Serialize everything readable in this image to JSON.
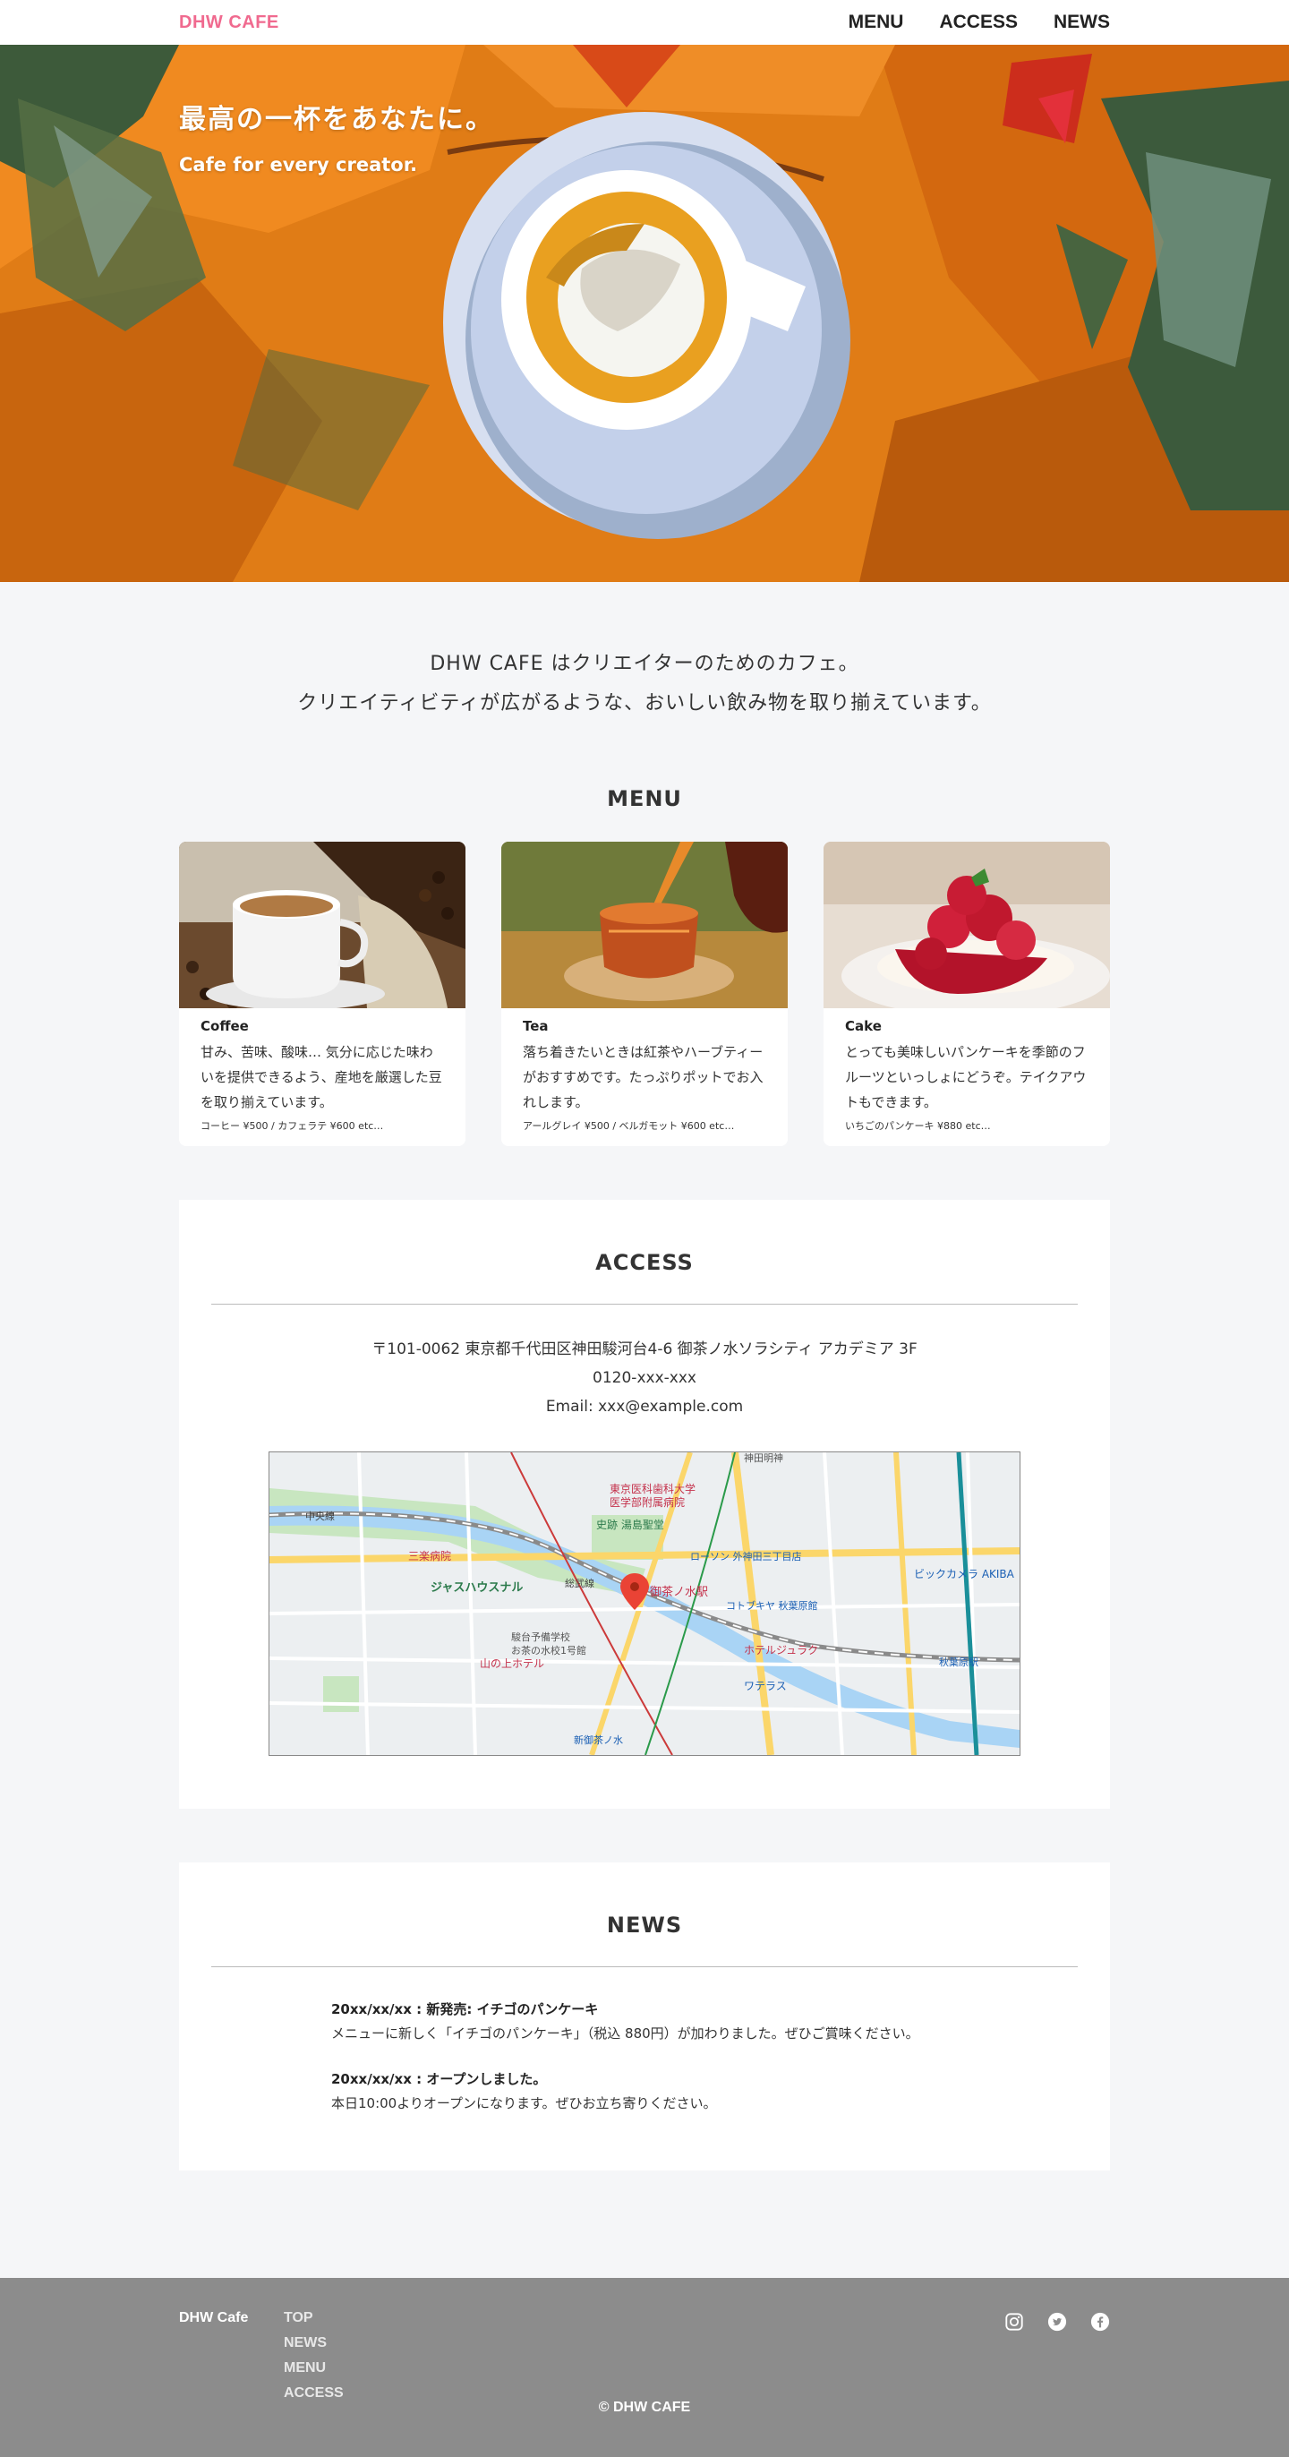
{
  "header": {
    "logo": "DHW CAFE",
    "nav": [
      "MENU",
      "ACCESS",
      "NEWS"
    ]
  },
  "hero": {
    "title": "最高の一杯をあなたに。",
    "subtitle": "Cafe for every creator."
  },
  "intro": {
    "line1": "DHW CAFE はクリエイターのためのカフェ。",
    "line2": "クリエイティビティが広がるような、おいしい飲み物を取り揃えています。"
  },
  "menu": {
    "title": "MENU",
    "items": [
      {
        "name": "Coffee",
        "desc": "甘み、苦味、酸味… 気分に応じた味わいを提供できるよう、産地を厳選した豆を取り揃えています。",
        "price": "コーヒー ¥500 / カフェラテ ¥600 etc…",
        "icon": "coffee-photo"
      },
      {
        "name": "Tea",
        "desc": "落ち着きたいときは紅茶やハーブティーがおすすめです。たっぷりポットでお入れします。",
        "price": "アールグレイ ¥500 / ベルガモット ¥600 etc…",
        "icon": "tea-photo"
      },
      {
        "name": "Cake",
        "desc": "とっても美味しいパンケーキを季節のフルーツといっしょにどうぞ。テイクアウトもできます。",
        "price": "いちごのパンケーキ ¥880 etc…",
        "icon": "cake-photo"
      }
    ]
  },
  "access": {
    "title": "ACCESS",
    "address": "〒101-0062 東京都千代田区神田駿河台4-6 御茶ノ水ソラシティ アカデミア 3F",
    "tel": "0120-xxx-xxx",
    "email": "Email:  xxx@example.com",
    "map": {
      "labels": [
        "東京医科歯科大学",
        "医学部附属病院",
        "史跡 湯島聖堂",
        "御茶ノ水駅",
        "ジャスハウスナル",
        "三楽病院",
        "山の上ホテル",
        "ワテラス",
        "ホテルジュラク",
        "秋葉原駅",
        "ビックカメラ AKIBA",
        "新御茶ノ水",
        "駿台予備学校",
        "お茶の水校1号館",
        "神田明神",
        "ローソン 外神田三丁目店",
        "コトブキヤ 秋葉原館",
        "中央線",
        "総武線"
      ],
      "pin_label": "御茶ノ水駅"
    }
  },
  "news": {
    "title": "NEWS",
    "items": [
      {
        "head": "20xx/xx/xx : 新発売: イチゴのパンケーキ",
        "text": "メニューに新しく「イチゴのパンケーキ」（税込 880円）が加わりました。ぜひご賞味ください。"
      },
      {
        "head": "20xx/xx/xx : オープンしました。",
        "text": "本日10:00よりオープンになります。ぜひお立ち寄りください。"
      }
    ]
  },
  "footer": {
    "brand": "DHW Cafe",
    "links": [
      "TOP",
      "NEWS",
      "MENU",
      "ACCESS"
    ],
    "social": [
      "instagram-icon",
      "twitter-icon",
      "facebook-icon"
    ],
    "copyright": "© DHW CAFE"
  },
  "colors": {
    "brand": "#f06a8f",
    "background": "#f5f6f8",
    "footer": "#8c8c8c"
  }
}
